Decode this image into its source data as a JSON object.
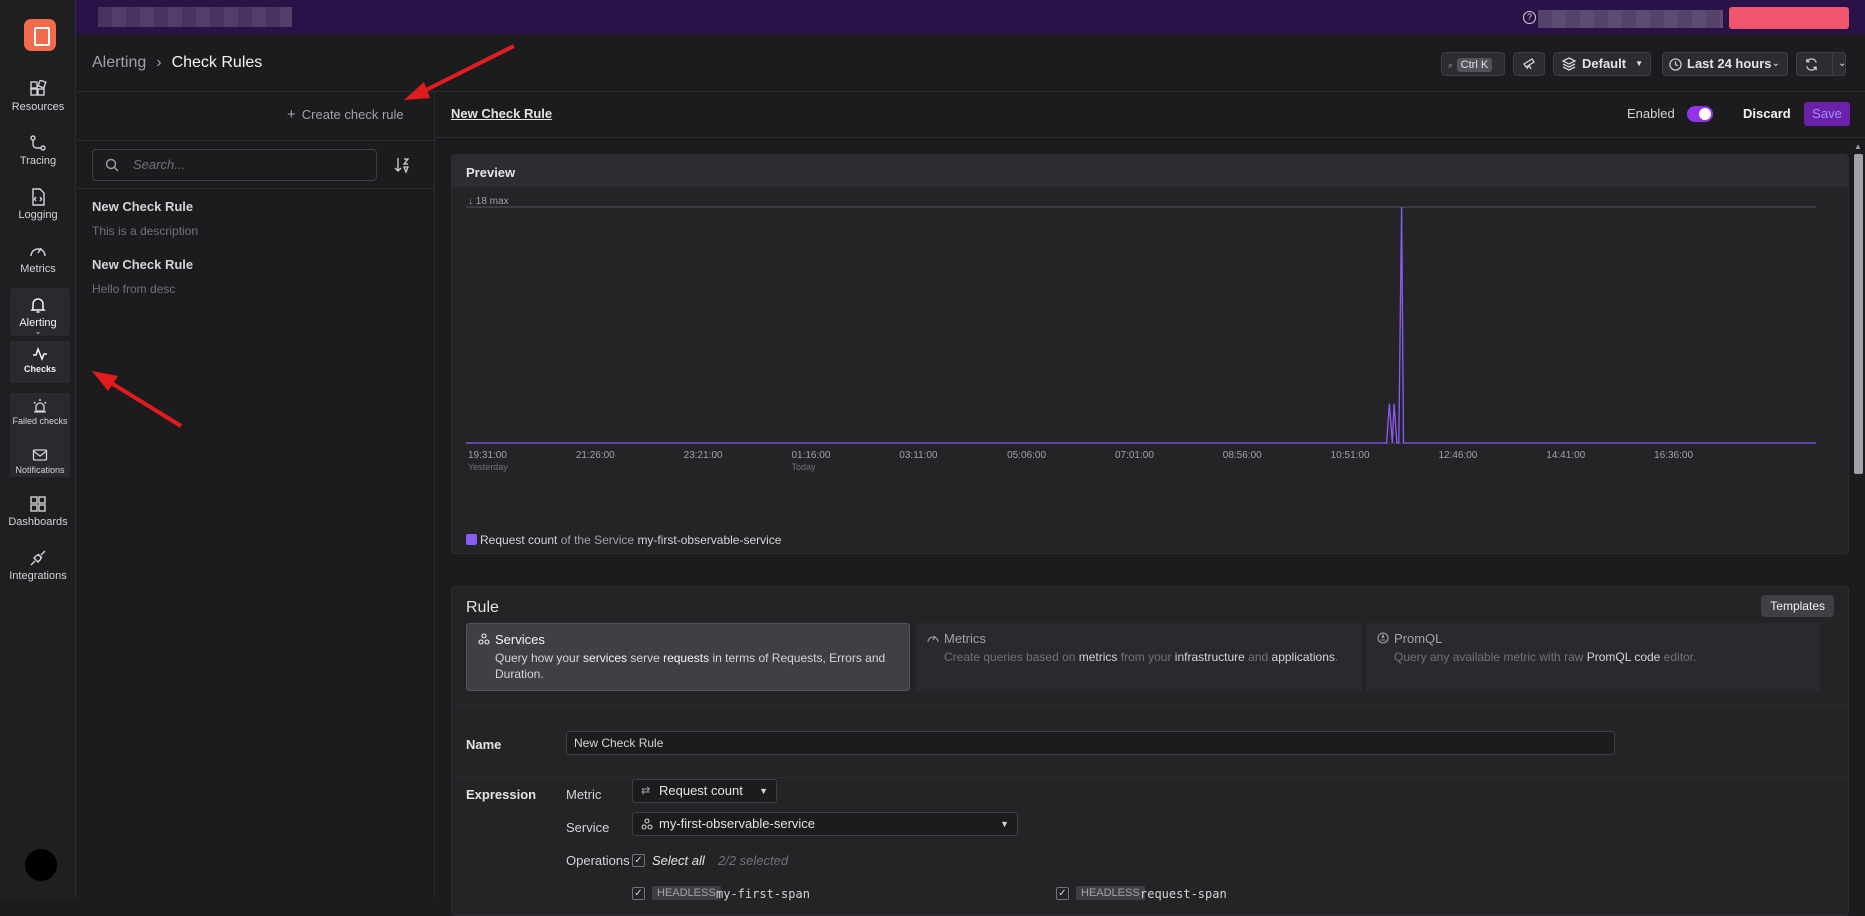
{
  "rail": {
    "items": [
      {
        "label": "Resources"
      },
      {
        "label": "Tracing"
      },
      {
        "label": "Logging"
      },
      {
        "label": "Metrics"
      },
      {
        "label": "Alerting"
      },
      {
        "label": "Dashboards"
      },
      {
        "label": "Integrations"
      }
    ],
    "sub": [
      {
        "label": "Checks"
      },
      {
        "label": "Failed checks"
      },
      {
        "label": "Notifications"
      }
    ]
  },
  "header": {
    "breadcrumb_parent": "Alerting",
    "breadcrumb_sep": "›",
    "breadcrumb_current": "Check Rules",
    "kbd": "Ctrl K",
    "env": "Default",
    "time_range": "Last 24 hours"
  },
  "left": {
    "create_label": "Create check rule",
    "search_placeholder": "Search...",
    "rules": [
      {
        "title": "New Check Rule",
        "description": "This is a description"
      },
      {
        "title": "New Check Rule",
        "description": "Hello from desc"
      }
    ]
  },
  "editor": {
    "title": "New Check Rule",
    "enabled_label": "Enabled",
    "discard_label": "Discard",
    "save_label": "Save"
  },
  "preview": {
    "heading": "Preview",
    "legend_metric": "Request count",
    "legend_mid": " of the Service ",
    "legend_service": "my-first-observable-service"
  },
  "chart_data": {
    "type": "line",
    "max_label": "↓ 18 max",
    "ylim": [
      0,
      18
    ],
    "x_ticks": [
      "19:31:00",
      "21:26:00",
      "23:21:00",
      "01:16:00",
      "03:11:00",
      "05:06:00",
      "07:01:00",
      "08:56:00",
      "10:51:00",
      "12:46:00",
      "14:41:00",
      "16:36:00"
    ],
    "x_tick_sub": {
      "0": "Yesterday",
      "3": "Today"
    },
    "series": [
      {
        "name": "Request count",
        "color": "#8b5cf6",
        "x": [
          "19:31:00",
          "11:51:00",
          "11:53:00",
          "11:56:00",
          "11:59:00",
          "12:01:00",
          "12:04:00",
          "12:06:00",
          "12:09:00",
          "12:11:00",
          "12:14:00",
          "12:16:00",
          "16:36:00",
          "19:31:00"
        ],
        "values": [
          0,
          0,
          0,
          3,
          0,
          3,
          0,
          0,
          18,
          0,
          0,
          0,
          0,
          0
        ]
      }
    ]
  },
  "rule": {
    "heading": "Rule",
    "templates_label": "Templates",
    "types": [
      {
        "title": "Services",
        "d1": "Query how your ",
        "b1": "services",
        "d2": " serve ",
        "b2": "requests",
        "d3": " in terms of Requests, Errors and Duration."
      },
      {
        "title": "Metrics",
        "d1": "Create queries based on ",
        "b1": "metrics",
        "d2": " from your ",
        "b2": "infrastructure",
        "d3": " and ",
        "b3": "applications",
        "d4": "."
      },
      {
        "title": "PromQL",
        "d1": "Query any available metric with raw ",
        "b1": "PromQL code",
        "d2": " editor."
      }
    ],
    "name_label": "Name",
    "name_value": "New Check Rule",
    "expression_label": "Expression",
    "metric_label": "Metric",
    "metric_value": "Request count",
    "service_label": "Service",
    "service_value": "my-first-observable-service",
    "operations_label": "Operations",
    "select_all": "Select all",
    "selected_count": "2/2 selected",
    "operations": [
      {
        "tag": "HEADLESS",
        "name": "my-first-span"
      },
      {
        "tag": "HEADLESS",
        "name": "request-span"
      }
    ]
  }
}
